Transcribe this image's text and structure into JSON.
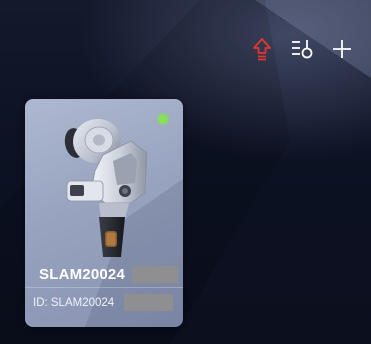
{
  "header": {
    "icons": [
      "upload-icon",
      "filter-settings-icon",
      "add-icon"
    ],
    "upload_color": "#e8372f",
    "icon_color": "#ffffff"
  },
  "device_card": {
    "name": "SLAM20024",
    "id_label": "ID: SLAM20024",
    "status_color": "#86e05a",
    "icon": "handheld-scanner-image"
  }
}
